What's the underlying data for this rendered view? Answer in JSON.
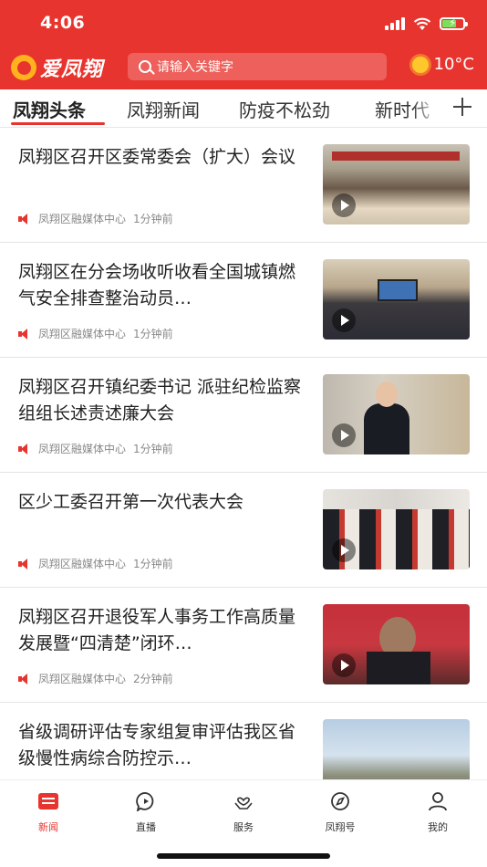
{
  "status_bar": {
    "time": "4:06"
  },
  "app": {
    "name": "爱凤翔"
  },
  "search": {
    "placeholder": "请输入关键字"
  },
  "weather": {
    "temperature": "10°C",
    "icon": "sun-icon"
  },
  "tabs": [
    {
      "label": "凤翔头条",
      "active": true
    },
    {
      "label": "凤翔新闻",
      "active": false
    },
    {
      "label": "防疫不松劲",
      "active": false
    },
    {
      "label": "新时代",
      "active": false
    }
  ],
  "news": [
    {
      "title": "凤翔区召开区委常委会（扩大）会议",
      "source": "凤翔区融媒体中心",
      "time": "1分钟前"
    },
    {
      "title": "凤翔区在分会场收听收看全国城镇燃气安全排查整治动员…",
      "source": "凤翔区融媒体中心",
      "time": "1分钟前"
    },
    {
      "title": "凤翔区召开镇纪委书记 派驻纪检监察组组长述责述廉大会",
      "source": "凤翔区融媒体中心",
      "time": "1分钟前"
    },
    {
      "title": "区少工委召开第一次代表大会",
      "source": "凤翔区融媒体中心",
      "time": "1分钟前"
    },
    {
      "title": "凤翔区召开退役军人事务工作高质量发展暨“四清楚”闭环…",
      "source": "凤翔区融媒体中心",
      "time": "2分钟前"
    },
    {
      "title": "省级调研评估专家组复审评估我区省级慢性病综合防控示…",
      "source": "",
      "time": ""
    }
  ],
  "bottom_nav": [
    {
      "label": "新闻",
      "icon": "news-icon",
      "active": true
    },
    {
      "label": "直播",
      "icon": "live-icon",
      "active": false
    },
    {
      "label": "服务",
      "icon": "service-icon",
      "active": false
    },
    {
      "label": "凤翔号",
      "icon": "compass-icon",
      "active": false
    },
    {
      "label": "我的",
      "icon": "user-icon",
      "active": false
    }
  ],
  "colors": {
    "brand": "#e8342e",
    "text": "#222222",
    "meta": "#888888"
  }
}
